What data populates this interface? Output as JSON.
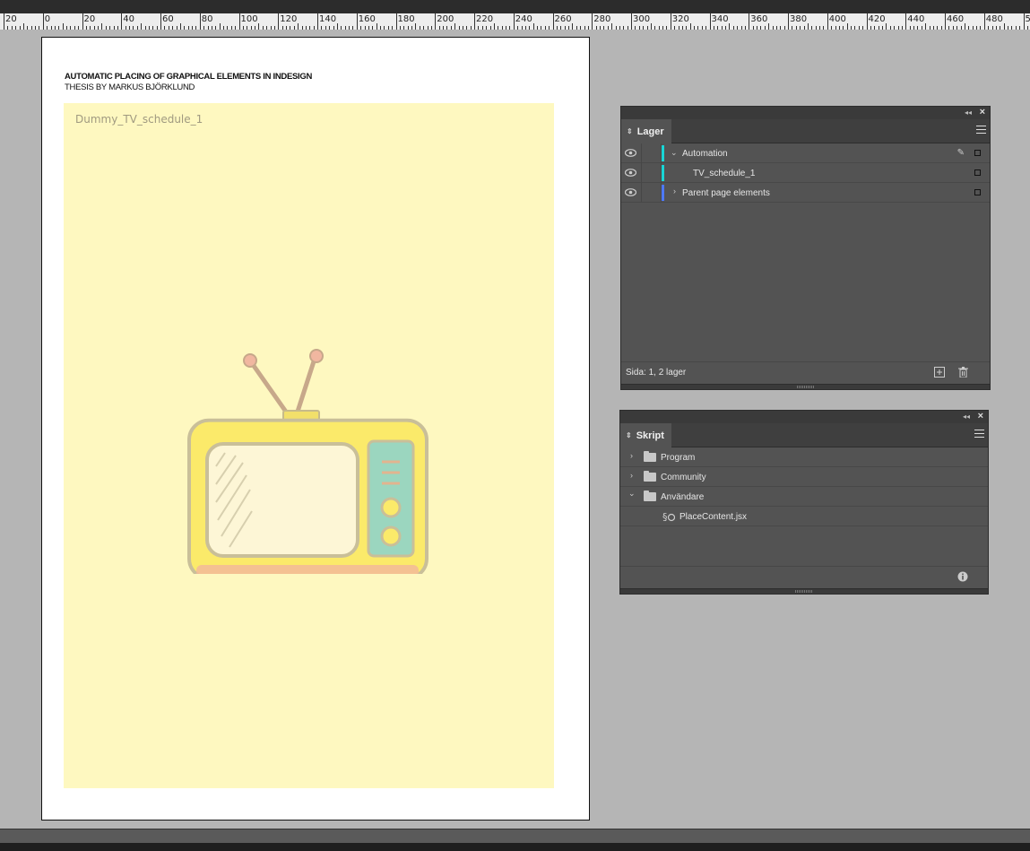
{
  "ruler": {
    "labels": [
      "20",
      "0",
      "20",
      "40",
      "60",
      "80",
      "100",
      "120",
      "140",
      "160",
      "180",
      "200",
      "220",
      "240",
      "260",
      "280",
      "300",
      "320",
      "340",
      "360",
      "380",
      "400",
      "420",
      "440",
      "460",
      "480",
      "50"
    ]
  },
  "document": {
    "title": "AUTOMATIC PLACING OF GRAPHICAL ELEMENTS IN INDESIGN",
    "subtitle": "THESIS BY MARKUS BJÖRKLUND",
    "frame_label": "Dummy_TV_schedule_1",
    "frame_color": "#fef8c0"
  },
  "layers_panel": {
    "tab": "Lager",
    "layers": [
      {
        "name": "Automation",
        "color": "#19d6d6",
        "expanded": true
      },
      {
        "name": "TV_schedule_1",
        "color": "#19d6d6",
        "child": true
      },
      {
        "name": "Parent page elements",
        "color": "#4d79ff",
        "expanded": false
      }
    ],
    "footer": "Sida: 1, 2 lager"
  },
  "scripts_panel": {
    "tab": "Skript",
    "items": [
      {
        "name": "Program",
        "type": "folder",
        "expanded": false
      },
      {
        "name": "Community",
        "type": "folder",
        "expanded": false
      },
      {
        "name": "Användare",
        "type": "folder",
        "expanded": true
      },
      {
        "name": "PlaceContent.jsx",
        "type": "script"
      }
    ]
  },
  "icons": {
    "eye": "eye-icon",
    "pen": "pen-icon",
    "new_layer": "new-layer-icon",
    "trash": "trash-icon",
    "info": "info-icon"
  }
}
